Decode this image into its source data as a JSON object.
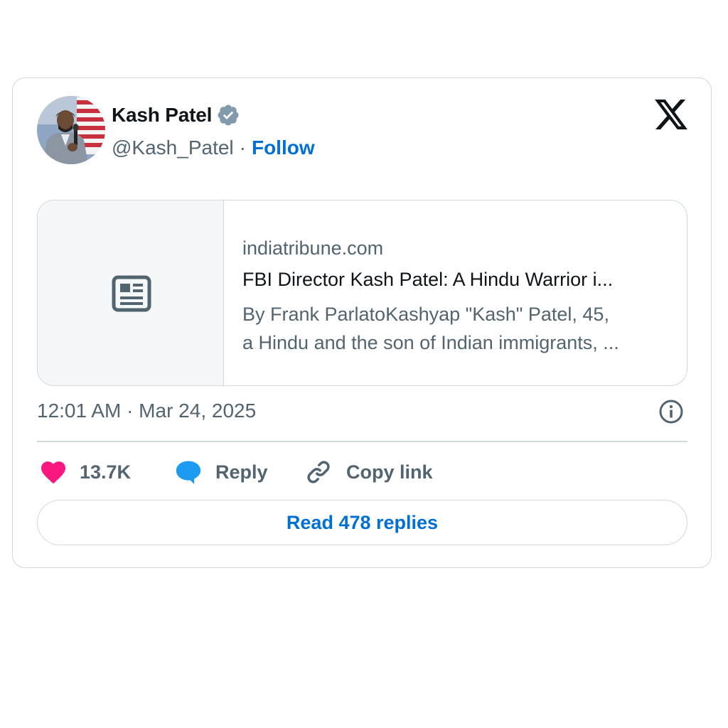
{
  "author": {
    "name": "Kash Patel",
    "handle": "@Kash_Patel",
    "separator": "·",
    "follow_label": "Follow",
    "verified_icon": "verified-badge-icon"
  },
  "brand": {
    "logo_icon": "x-logo-icon"
  },
  "link_card": {
    "thumbnail_icon": "newspaper-icon",
    "domain": "indiatribune.com",
    "title": "FBI Director Kash Patel: A Hindu Warrior i...",
    "description_line1": "By Frank ParlatoKashyap \"Kash\" Patel, 45,",
    "description_line2": "a Hindu and the son of Indian immigrants, ..."
  },
  "meta": {
    "timestamp": "12:01 AM · Mar 24, 2025",
    "info_icon": "info-icon"
  },
  "actions": {
    "like_count": "13.7K",
    "reply_label": "Reply",
    "copy_link_label": "Copy link"
  },
  "footer": {
    "read_replies_label": "Read 478 replies"
  },
  "colors": {
    "accent": "#006fd6",
    "like": "#f91880",
    "reply": "#1d9bf0",
    "secondary_text": "#536471",
    "border": "#cfd9de"
  }
}
